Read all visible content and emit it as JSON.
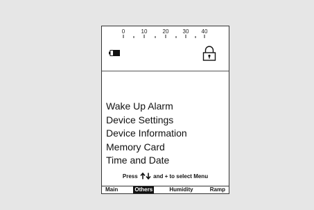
{
  "scale": {
    "labels": [
      "0",
      "10",
      "20",
      "30",
      "40"
    ]
  },
  "status": {
    "battery_icon": "battery-low-icon",
    "lock_icon": "padlock-icon"
  },
  "menu": {
    "items": [
      "Wake Up Alarm",
      "Device Settings",
      "Device Information",
      "Memory Card",
      "Time and Date"
    ]
  },
  "hint": {
    "press": "Press",
    "rest": "and + to select Menu",
    "arrows_icon": "up-down-arrows-icon"
  },
  "tabs": [
    {
      "label": "Main",
      "active": false
    },
    {
      "label": "Others",
      "active": true
    },
    {
      "label": "Humidity",
      "active": false
    },
    {
      "label": "Ramp",
      "active": false
    }
  ],
  "colors": {
    "background": "#e6e6e6",
    "screen": "#ffffff",
    "ink": "#111111"
  }
}
